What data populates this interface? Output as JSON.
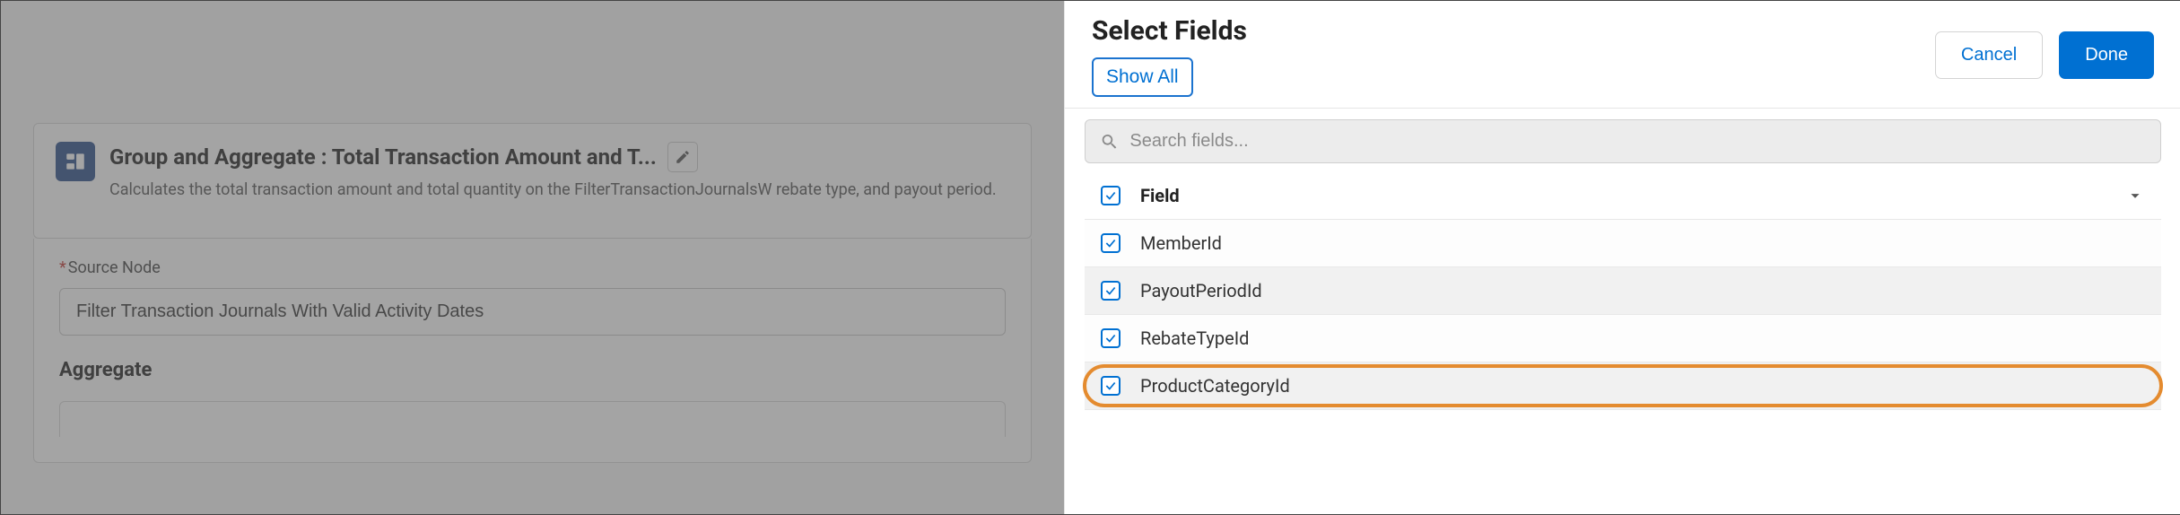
{
  "bg": {
    "title": "Group and Aggregate :  Total Transaction Amount and T...",
    "desc": "Calculates the total transaction amount and total quantity on the FilterTransactionJournalsW                                                                  rebate type, and payout period.",
    "sourceLabel": "Source Node",
    "sourceValue": "Filter Transaction Journals With Valid Activity Dates",
    "aggregateLabel": "Aggregate"
  },
  "panel": {
    "title": "Select Fields",
    "showAll": "Show All",
    "cancel": "Cancel",
    "done": "Done",
    "searchPlaceholder": "Search fields...",
    "columnHeader": "Field",
    "fields": [
      {
        "label": "MemberId"
      },
      {
        "label": "PayoutPeriodId"
      },
      {
        "label": "RebateTypeId"
      },
      {
        "label": "ProductCategoryId"
      }
    ]
  }
}
